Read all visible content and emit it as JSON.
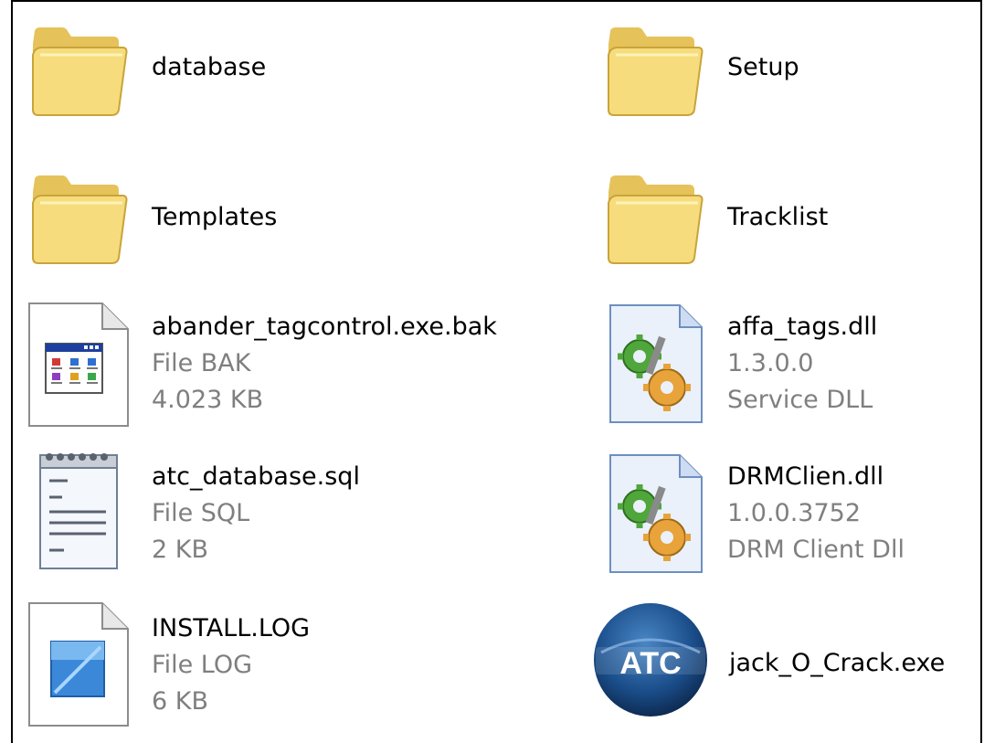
{
  "items": [
    {
      "name": "database",
      "icon": "folder-icon"
    },
    {
      "name": "Setup",
      "icon": "folder-icon"
    },
    {
      "name": "Templates",
      "icon": "folder-icon"
    },
    {
      "name": "Tracklist",
      "icon": "folder-icon"
    },
    {
      "name": "abander_tagcontrol.exe.bak",
      "type": "File BAK",
      "size": "4.023 KB",
      "icon": "application-window-icon"
    },
    {
      "name": "affa_tags.dll",
      "version": "1.3.0.0",
      "description": "Service DLL",
      "icon": "dll-gear-icon"
    },
    {
      "name": "atc_database.sql",
      "type": "File SQL",
      "size": "2 KB",
      "icon": "notepad-icon"
    },
    {
      "name": "DRMClien.dll",
      "version": "1.0.0.3752",
      "description": "DRM Client Dll",
      "icon": "dll-gear-icon"
    },
    {
      "name": "INSTALL.LOG",
      "type": "File LOG",
      "size": "6 KB",
      "icon": "log-file-icon"
    },
    {
      "name": "jack_O_Crack.exe",
      "icon": "atc-logo-icon",
      "logo_text": "ATC"
    }
  ],
  "colors": {
    "folder": "#f3d36a",
    "folder_dark": "#c9a43a",
    "text": "#000000",
    "details_text": "#7f7f7f",
    "atc_blue": "#1b4f8c"
  }
}
